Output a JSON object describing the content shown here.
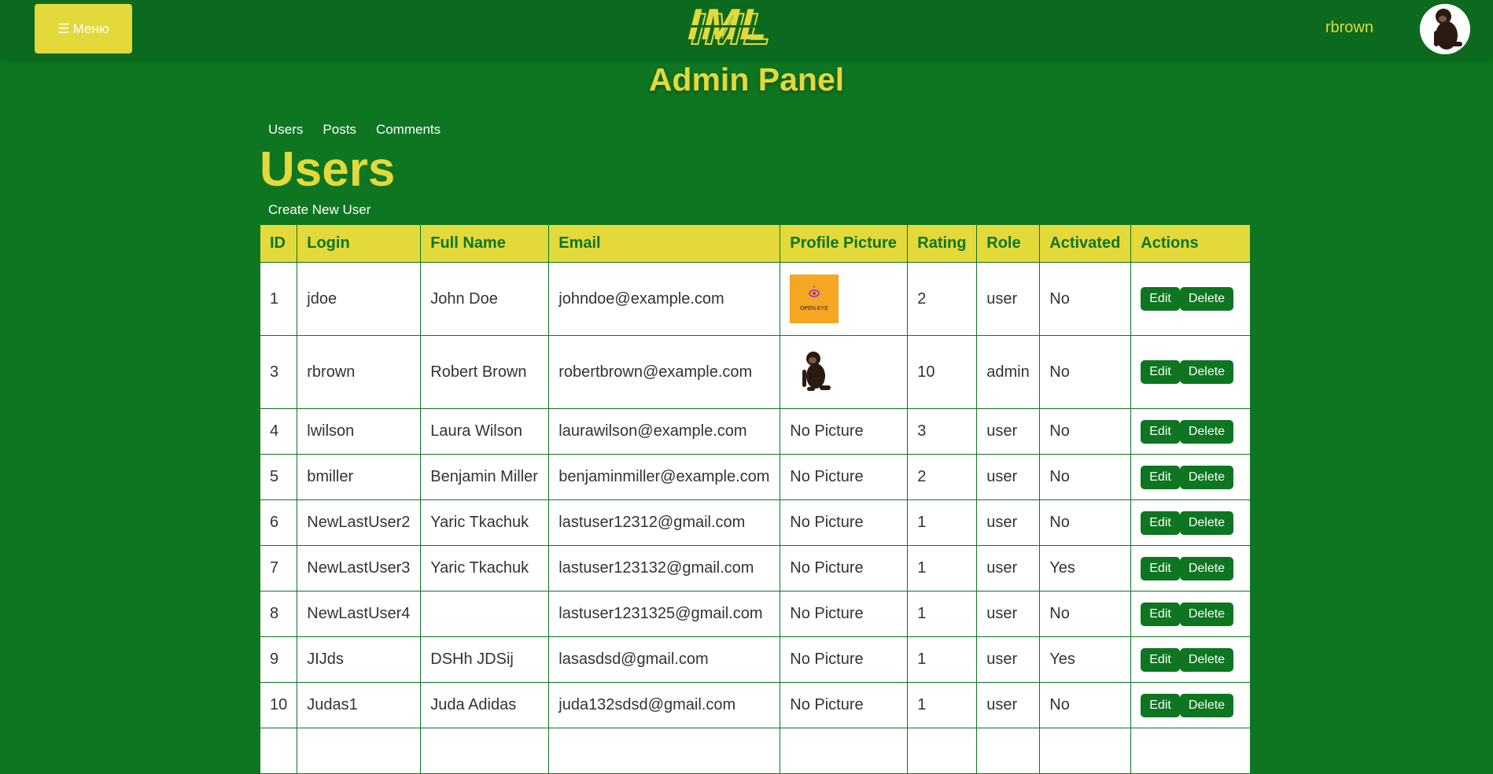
{
  "header": {
    "menu_icon": "☰",
    "menu_label": "Меню",
    "logo_text": "IML",
    "username": "rbrown",
    "colors": {
      "accent": "#e3d93b",
      "background": "#0e7521",
      "header": "#0b6a1d"
    }
  },
  "page": {
    "title": "Admin Panel",
    "tabs": [
      {
        "label": "Users"
      },
      {
        "label": "Posts"
      },
      {
        "label": "Comments"
      }
    ],
    "section_title": "Users",
    "create_link": "Create New User"
  },
  "table": {
    "headers": [
      "ID",
      "Login",
      "Full Name",
      "Email",
      "Profile Picture",
      "Rating",
      "Role",
      "Activated",
      "Actions"
    ],
    "edit_label": "Edit",
    "delete_label": "Delete",
    "rows": [
      {
        "id": "1",
        "login": "jdoe",
        "full_name": "John Doe",
        "email": "johndoe@example.com",
        "picture": "open-eye-logo",
        "picture_text": "OPEN EYE",
        "rating": "2",
        "role": "user",
        "activated": "No"
      },
      {
        "id": "3",
        "login": "rbrown",
        "full_name": "Robert Brown",
        "email": "robertbrown@example.com",
        "picture": "chimpanzee-photo",
        "rating": "10",
        "role": "admin",
        "activated": "No"
      },
      {
        "id": "4",
        "login": "lwilson",
        "full_name": "Laura Wilson",
        "email": "laurawilson@example.com",
        "picture_text": "No Picture",
        "rating": "3",
        "role": "user",
        "activated": "No"
      },
      {
        "id": "5",
        "login": "bmiller",
        "full_name": "Benjamin Miller",
        "email": "benjaminmiller@example.com",
        "picture_text": "No Picture",
        "rating": "2",
        "role": "user",
        "activated": "No"
      },
      {
        "id": "6",
        "login": "NewLastUser2",
        "full_name": "Yaric Tkachuk",
        "email": "lastuser12312@gmail.com",
        "picture_text": "No Picture",
        "rating": "1",
        "role": "user",
        "activated": "No"
      },
      {
        "id": "7",
        "login": "NewLastUser3",
        "full_name": "Yaric Tkachuk",
        "email": "lastuser123132@gmail.com",
        "picture_text": "No Picture",
        "rating": "1",
        "role": "user",
        "activated": "Yes"
      },
      {
        "id": "8",
        "login": "NewLastUser4",
        "full_name": "",
        "email": "lastuser1231325@gmail.com",
        "picture_text": "No Picture",
        "rating": "1",
        "role": "user",
        "activated": "No"
      },
      {
        "id": "9",
        "login": "JIJds",
        "full_name": "DSHh JDSij",
        "email": "lasasdsd@gmail.com",
        "picture_text": "No Picture",
        "rating": "1",
        "role": "user",
        "activated": "Yes"
      },
      {
        "id": "10",
        "login": "Judas1",
        "full_name": "Juda Adidas",
        "email": "juda132sdsd@gmail.com",
        "picture_text": "No Picture",
        "rating": "1",
        "role": "user",
        "activated": "No"
      },
      {
        "id": "",
        "login": "",
        "full_name": "",
        "email": "",
        "picture_text": "",
        "rating": "",
        "role": "",
        "activated": ""
      }
    ]
  }
}
